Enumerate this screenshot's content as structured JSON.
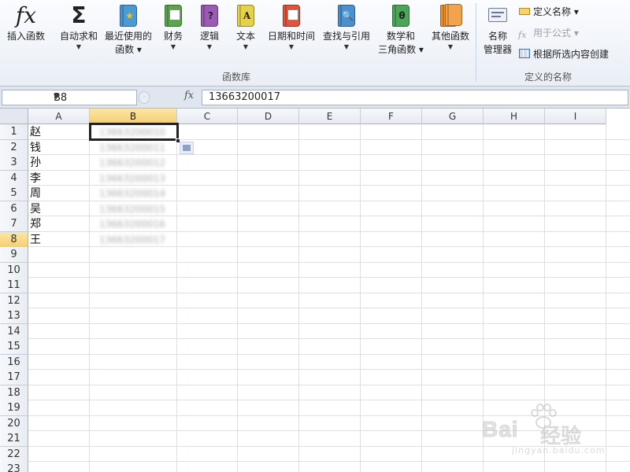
{
  "ribbon": {
    "insert_function": "插入函数",
    "autosum": "自动求和",
    "recent_line1": "最近使用的",
    "recent_line2": "函数",
    "financial": "财务",
    "logical": "逻辑",
    "text": "文本",
    "datetime": "日期和时间",
    "lookup": "查找与引用",
    "math_line1": "数学和",
    "math_line2": "三角函数",
    "other": "其他函数",
    "group_function_library": "函数库",
    "name_manager_line1": "名称",
    "name_manager_line2": "管理器",
    "define_name": "定义名称",
    "use_in_formula": "用于公式",
    "create_from_selection": "根据所选内容创建",
    "group_defined_names": "定义的名称",
    "colors": {
      "financial": "#5aa64a",
      "logical": "#9a5bb5",
      "text": "#e6d24a",
      "datetime": "#e2533b",
      "lookup": "#4a8fd0",
      "math": "#4ba65a",
      "other": "#f0912e",
      "recent": "#4a9ad8"
    }
  },
  "formula_bar": {
    "name_box": "B8",
    "fx": "fx",
    "content": "13663200017"
  },
  "grid": {
    "columns": [
      "A",
      "B",
      "C",
      "D",
      "E",
      "F",
      "G",
      "H",
      "I"
    ],
    "rows": [
      "1",
      "2",
      "3",
      "4",
      "5",
      "6",
      "7",
      "8",
      "9",
      "10",
      "11",
      "12",
      "13",
      "14",
      "15",
      "16",
      "17",
      "18",
      "19",
      "20",
      "21",
      "22",
      "23"
    ],
    "names": [
      "赵",
      "钱",
      "孙",
      "李",
      "周",
      "吴",
      "郑",
      "王"
    ],
    "phones": [
      "13663200010",
      "13663200011",
      "13663200012",
      "13663200013",
      "13663200014",
      "13663200015",
      "13663200016",
      "13663200017"
    ]
  },
  "watermark": {
    "brand": "Bai",
    "brand_cn": "经验",
    "url": "jingyan.baidu.com"
  }
}
